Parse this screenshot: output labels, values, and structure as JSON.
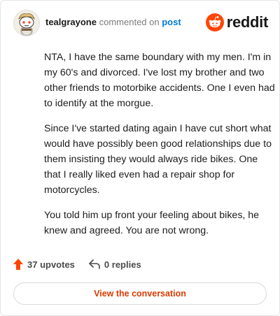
{
  "header": {
    "username": "tealgrayone",
    "action_text": "commented on",
    "post_link": "post",
    "avatar_icon": "snoo-avatar-icon"
  },
  "brand": {
    "logo_icon": "reddit-logo-icon",
    "wordmark": "reddit",
    "accent_color": "#ff4500"
  },
  "comment": {
    "paragraphs": [
      "NTA, I have the same boundary with my men. I'm in my 60's and divorced. I've lost my brother and two other friends to motorbike accidents. One I even had to identify at the morgue.",
      "Since I've started dating again I have cut short what would have possibly been good relationships due to them insisting they would always ride bikes. One that I really liked even had a repair shop for motorcycles.",
      "You told him up front your feeling about bikes, he knew and agreed. You are not wrong."
    ]
  },
  "footer": {
    "upvotes_label": "37 upvotes",
    "replies_label": "0 replies",
    "upvote_icon": "upvote-arrow-icon",
    "reply_icon": "reply-arrow-icon"
  },
  "cta": {
    "label": "View the conversation",
    "color": "#d93a00"
  }
}
